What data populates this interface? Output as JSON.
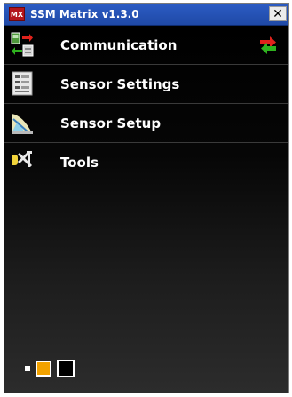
{
  "window": {
    "title": "SSM Matrix v1.3.0",
    "app_icon_text": "MX",
    "close_label": "✕"
  },
  "menu": {
    "items": [
      {
        "label": "Communication",
        "icon": "connection-icon"
      },
      {
        "label": "Sensor Settings",
        "icon": "settings-sheet-icon"
      },
      {
        "label": "Sensor Setup",
        "icon": "sensor-setup-icon"
      },
      {
        "label": "Tools",
        "icon": "tools-icon"
      }
    ]
  },
  "status": {
    "connection_icon": "transfer-arrows-icon"
  },
  "footer": {
    "swatches": [
      "small",
      "medium",
      "large"
    ],
    "accent_color": "#f2a200"
  },
  "colors": {
    "titlebar": "#2c5cc4",
    "background": "#000000",
    "text": "#ffffff"
  }
}
